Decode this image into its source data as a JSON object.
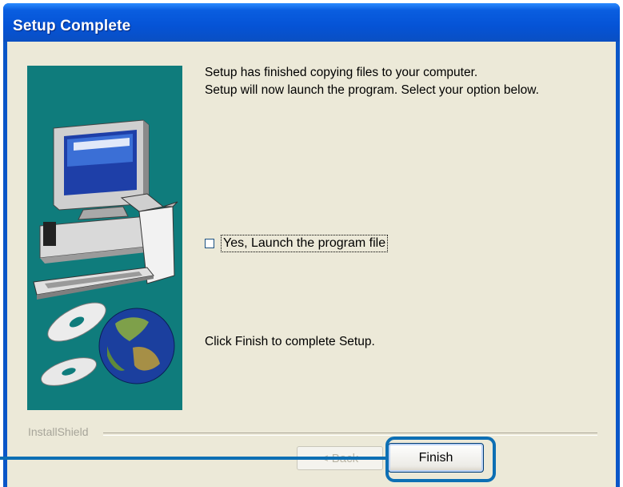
{
  "window": {
    "title": "Setup Complete"
  },
  "content": {
    "message_line1": "Setup has finished copying files to your computer.",
    "message_line2": "Setup will now launch the program. Select your option below.",
    "launch_checkbox_label": "Yes, Launch the program file",
    "launch_checkbox_checked": false,
    "finish_message": "Click Finish to complete Setup."
  },
  "footer": {
    "brand": "InstallShield",
    "back_label": "< Back",
    "finish_label": "Finish"
  },
  "colors": {
    "title_bar": "#0553d6",
    "panel": "#ece9d8",
    "image_background": "#0f7c7c",
    "callout": "#0d6fb4"
  },
  "icons": [
    "computer-illustration",
    "cd-discs-icon",
    "globe-icon"
  ]
}
